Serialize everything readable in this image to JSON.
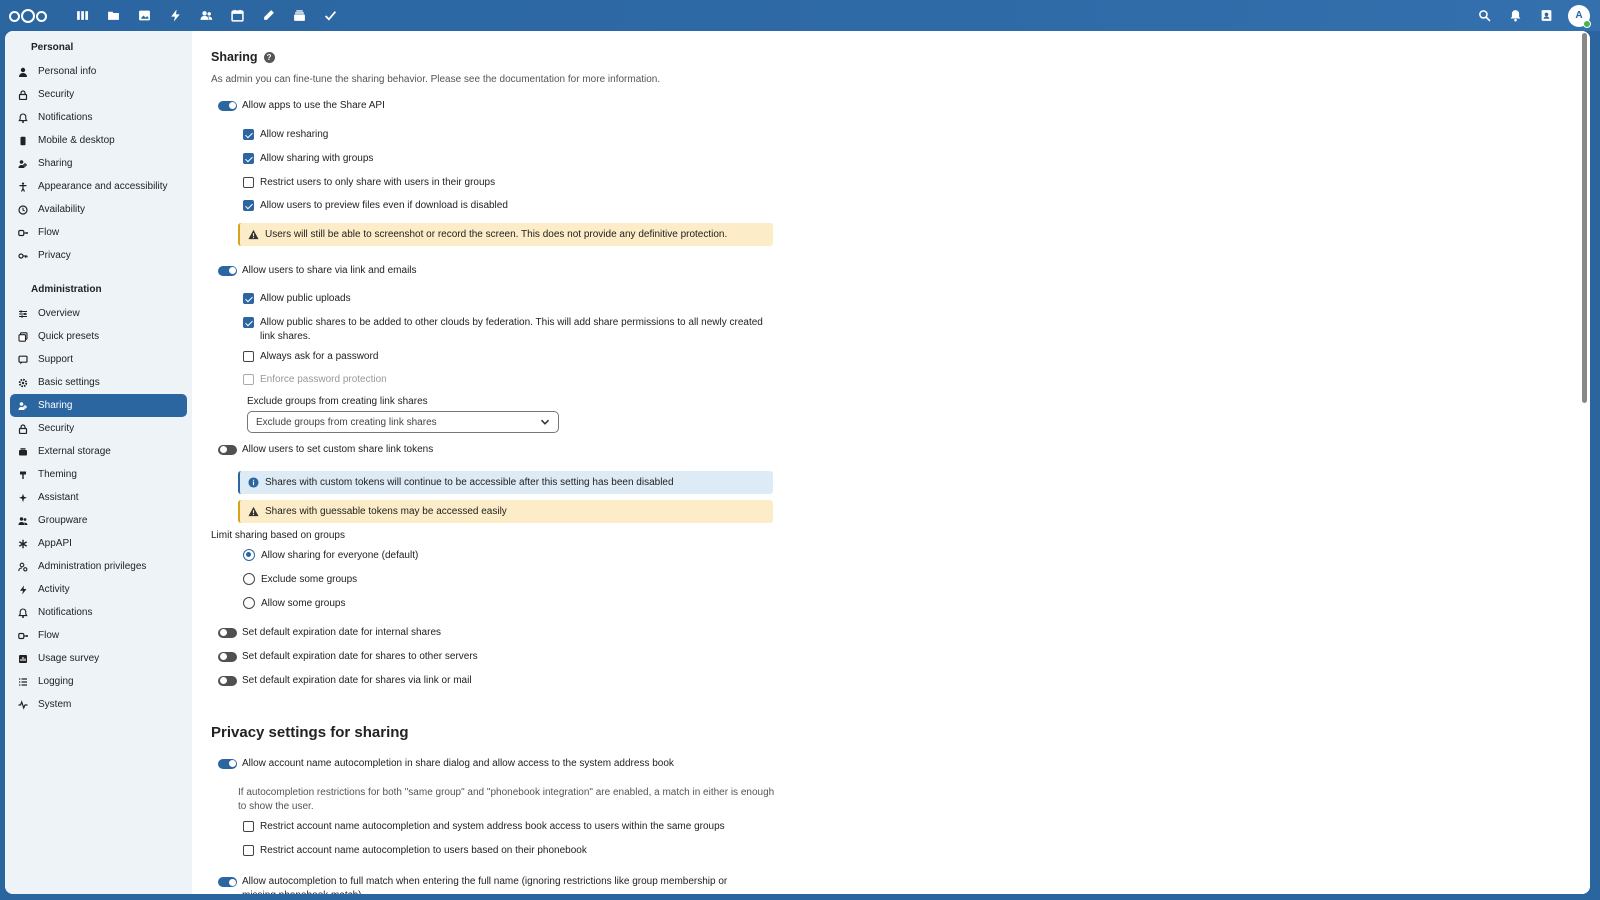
{
  "topbar": {
    "apps": [
      {
        "icon": "dashboard-icon"
      },
      {
        "icon": "files-icon"
      },
      {
        "icon": "photos-icon"
      },
      {
        "icon": "activity-icon"
      },
      {
        "icon": "contacts-icon"
      },
      {
        "icon": "calendar-icon"
      },
      {
        "icon": "notes-icon"
      },
      {
        "icon": "deck-icon"
      },
      {
        "icon": "tasks-icon"
      }
    ],
    "avatar_initial": "A"
  },
  "sidebar": {
    "personal_heading": "Personal",
    "personal_items": [
      {
        "label": "Personal info",
        "icon": "person-icon"
      },
      {
        "label": "Security",
        "icon": "lock-icon"
      },
      {
        "label": "Notifications",
        "icon": "bell-icon"
      },
      {
        "label": "Mobile & desktop",
        "icon": "phone-icon"
      },
      {
        "label": "Sharing",
        "icon": "share-icon"
      },
      {
        "label": "Appearance and accessibility",
        "icon": "accessibility-icon"
      },
      {
        "label": "Availability",
        "icon": "clock-icon"
      },
      {
        "label": "Flow",
        "icon": "flow-icon"
      },
      {
        "label": "Privacy",
        "icon": "key-icon"
      }
    ],
    "admin_heading": "Administration",
    "admin_items": [
      {
        "label": "Overview",
        "icon": "sliders-icon"
      },
      {
        "label": "Quick presets",
        "icon": "presets-icon"
      },
      {
        "label": "Support",
        "icon": "support-icon"
      },
      {
        "label": "Basic settings",
        "icon": "gear-icon"
      },
      {
        "label": "Sharing",
        "icon": "share-icon",
        "active": true
      },
      {
        "label": "Security",
        "icon": "lock-icon"
      },
      {
        "label": "External storage",
        "icon": "storage-icon"
      },
      {
        "label": "Theming",
        "icon": "brush-icon"
      },
      {
        "label": "Assistant",
        "icon": "sparkle-icon"
      },
      {
        "label": "Groupware",
        "icon": "group-icon"
      },
      {
        "label": "AppAPI",
        "icon": "appapi-icon"
      },
      {
        "label": "Administration privileges",
        "icon": "admin-icon"
      },
      {
        "label": "Activity",
        "icon": "activity-icon"
      },
      {
        "label": "Notifications",
        "icon": "bell-icon"
      },
      {
        "label": "Flow",
        "icon": "flow-icon"
      },
      {
        "label": "Usage survey",
        "icon": "chart-icon"
      },
      {
        "label": "Logging",
        "icon": "list-icon"
      },
      {
        "label": "System",
        "icon": "pulse-icon"
      }
    ]
  },
  "sharing": {
    "title": "Sharing",
    "help_glyph": "?",
    "description": "As admin you can fine-tune the sharing behavior. Please see the documentation for more information.",
    "allow_share_api": "Allow apps to use the Share API",
    "allow_resharing": "Allow resharing",
    "allow_groups": "Allow sharing with groups",
    "restrict_groups": "Restrict users to only share with users in their groups",
    "allow_preview": "Allow users to preview files even if download is disabled",
    "warn_screenshot": "Users will still be able to screenshot or record the screen. This does not provide any definitive protection.",
    "allow_links": "Allow users to share via link and emails",
    "allow_public_uploads": "Allow public uploads",
    "allow_federation": "Allow public shares to be added to other clouds by federation. This will add share permissions to all newly created link shares.",
    "always_password": "Always ask for a password",
    "enforce_password": "Enforce password protection",
    "exclude_groups_label": "Exclude groups from creating link shares",
    "exclude_groups_placeholder": "Exclude groups from creating link shares",
    "custom_tokens": "Allow users to set custom share link tokens",
    "info_tokens": "Shares with custom tokens will continue to be accessible after this setting has been disabled",
    "warn_tokens": "Shares with guessable tokens may be accessed easily",
    "limit_label": "Limit sharing based on groups",
    "radio_everyone": "Allow sharing for everyone (default)",
    "radio_exclude": "Exclude some groups",
    "radio_allow": "Allow some groups",
    "expire_internal": "Set default expiration date for internal shares",
    "expire_remote": "Set default expiration date for shares to other servers",
    "expire_link": "Set default expiration date for shares via link or mail"
  },
  "privacy": {
    "title": "Privacy settings for sharing",
    "autocomplete": "Allow account name autocompletion in share dialog and allow access to the system address book",
    "autocomplete_hint": "If autocompletion restrictions for both \"same group\" and \"phonebook integration\" are enabled, a match in either is enough to show the user.",
    "restrict_same_group": "Restrict account name autocompletion and system address book access to users within the same groups",
    "restrict_phonebook": "Restrict account name autocompletion to users based on their phonebook",
    "full_match": "Allow autocompletion to full match when entering the full name (ignoring restrictions like group membership or missing phonebook match)"
  },
  "colors": {
    "primary": "#2b66a1",
    "warning_bg": "#fcedc8",
    "info_bg": "#dcebf6",
    "sidebar_bg": "#eef3f8"
  }
}
